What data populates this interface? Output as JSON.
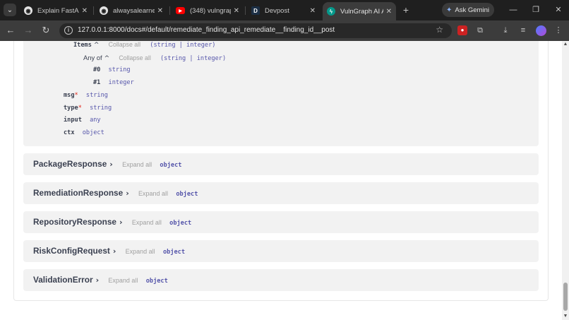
{
  "browser": {
    "tabs": [
      {
        "title": "Explain FastAPI",
        "favicon_color": "#e3e3e3",
        "favicon_glyph": "◉"
      },
      {
        "title": "alwaysalearner1",
        "favicon_color": "#e3e3e3",
        "favicon_glyph": "◉"
      },
      {
        "title": "(348) vulngraph",
        "favicon_color": "#ff0000",
        "favicon_glyph": "▶"
      },
      {
        "title": "Devpost",
        "favicon_color": "#1c2f45",
        "favicon_glyph": "D"
      },
      {
        "title": "VulnGraph AI A",
        "favicon_color": "#05998b",
        "favicon_glyph": "ϟ"
      }
    ],
    "ask_gemini": "Ask Gemini",
    "url": "127.0.0.1:8000/docs#/default/remediate_finding_api_remediate__finding_id__post"
  },
  "schema": {
    "open_model": {
      "items_label": "Items",
      "items_collapse": "Collapse all",
      "items_types": "(string | integer)",
      "anyof_label": "Any of",
      "anyof_collapse": "Collapse all",
      "anyof_types": "(string | integer)",
      "variant0_key": "#0",
      "variant0_type": "string",
      "variant1_key": "#1",
      "variant1_type": "integer",
      "props": [
        {
          "name": "msg",
          "req": "*",
          "type": "string"
        },
        {
          "name": "type",
          "req": "*",
          "type": "string"
        },
        {
          "name": "input",
          "req": "",
          "type": "any"
        },
        {
          "name": "ctx",
          "req": "",
          "type": "object"
        }
      ]
    },
    "models": [
      {
        "name": "PackageResponse",
        "expand": "Expand all",
        "type": "object"
      },
      {
        "name": "RemediationResponse",
        "expand": "Expand all",
        "type": "object"
      },
      {
        "name": "RepositoryResponse",
        "expand": "Expand all",
        "type": "object"
      },
      {
        "name": "RiskConfigRequest",
        "expand": "Expand all",
        "type": "object"
      },
      {
        "name": "ValidationError",
        "expand": "Expand all",
        "type": "object"
      }
    ]
  }
}
